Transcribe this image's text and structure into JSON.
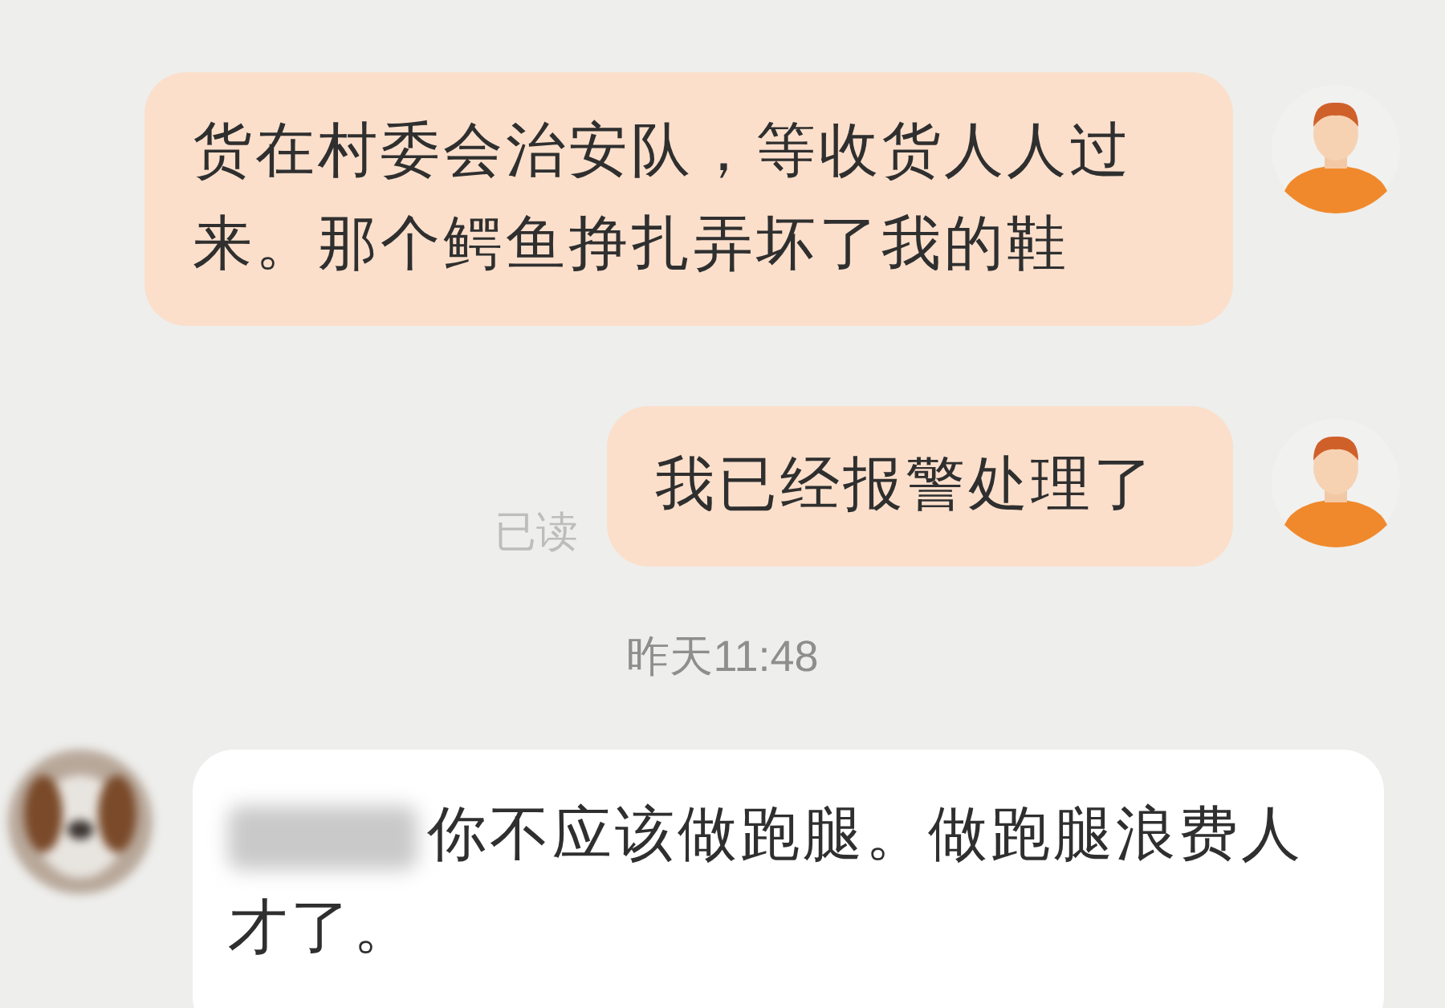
{
  "messages": [
    {
      "kind": "outgoing",
      "text": "货在村委会治安队，等收货人人过来。那个鳄鱼挣扎弄坏了我的鞋"
    },
    {
      "kind": "outgoing",
      "text": "我已经报警处理了",
      "status": "已读"
    },
    {
      "kind": "time",
      "text": "昨天11:48"
    },
    {
      "kind": "incoming",
      "text": "你不应该做跑腿。做跑腿浪费人才了。"
    }
  ]
}
